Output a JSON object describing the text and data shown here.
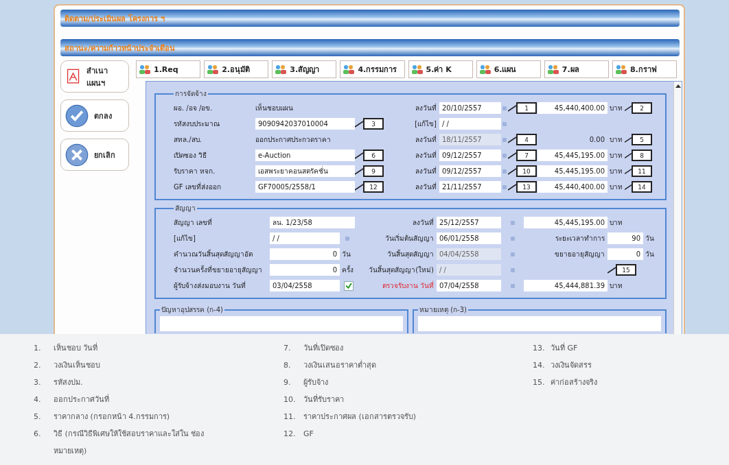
{
  "title_bars": [
    "ติดตาม/ประเมินผล โครงการ ฯ",
    "สถานะ/ความก้าวหน้าประจำเดือน"
  ],
  "side_buttons": [
    {
      "kind": "copy",
      "label": "สำเนา แผนฯ"
    },
    {
      "kind": "ok",
      "label": "ตกลง"
    },
    {
      "kind": "cancel",
      "label": "ยกเลิก"
    }
  ],
  "tabs": [
    {
      "label": "1.Req",
      "selected": false
    },
    {
      "label": "2.อนุมัติ",
      "selected": false
    },
    {
      "label": "3.สัญญา",
      "selected": false
    },
    {
      "label": "4.กรรมการ",
      "selected": false
    },
    {
      "label": "5.ค่า K",
      "selected": false
    },
    {
      "label": "6.แผน",
      "selected": false
    },
    {
      "label": "7.ผล",
      "selected": false
    },
    {
      "label": "8.กราฟ",
      "selected": false
    }
  ],
  "procurement": {
    "legend": "การจัดจ้าง",
    "rows": [
      {
        "label": "ผอ. /อจ /อข.",
        "value": {
          "kind": "text",
          "text": "เห็นชอบแผน"
        },
        "date_label": "ลงวันที่",
        "date": "20/10/2557",
        "date_disabled": false,
        "date_callout": "1",
        "amount": {
          "kind": "field",
          "text": "45,440,400.00"
        },
        "unit": "บาท",
        "amount_callout": "2"
      },
      {
        "label": "รหัสงบประมาณ",
        "value": {
          "kind": "field",
          "text": "9090942037010004"
        },
        "value_callout": "3",
        "date_label": "[แก้ไข]",
        "date": "/ /",
        "date_disabled": false
      },
      {
        "label": "สทล./สบ.",
        "value": {
          "kind": "text",
          "text": "ออกประกาศประกวดราคา"
        },
        "date_label": "ลงวันที่",
        "date": "18/11/2557",
        "date_disabled": true,
        "date_callout": "4",
        "amount": {
          "kind": "text",
          "text": "0.00"
        },
        "unit": "บาท",
        "amount_callout": "5"
      },
      {
        "label": "เปิดซอง วิธี",
        "value": {
          "kind": "field",
          "text": "e-Auction"
        },
        "value_callout": "6",
        "date_label": "ลงวันที่",
        "date": "09/12/2557",
        "date_disabled": false,
        "date_callout": "7",
        "amount": {
          "kind": "field",
          "text": "45,445,195.00"
        },
        "unit": "บาท",
        "amount_callout": "8"
      },
      {
        "label": "รับราคา หจก.",
        "value": {
          "kind": "field",
          "text": "เอสพระยาคอนสตรัคชั่น"
        },
        "value_callout": "9",
        "date_label": "ลงวันที่",
        "date": "09/12/2557",
        "date_disabled": false,
        "date_callout": "10",
        "amount": {
          "kind": "field",
          "text": "45,445,195.00"
        },
        "unit": "บาท",
        "amount_callout": "11"
      },
      {
        "label": "GF เลขที่ส่งออก",
        "value": {
          "kind": "field",
          "text": "GF70005/2558/1"
        },
        "value_callout": "12",
        "date_label": "ลงวันที่",
        "date": "21/11/2557",
        "date_disabled": false,
        "date_callout": "13",
        "amount": {
          "kind": "field",
          "text": "45,440,400.00"
        },
        "unit": "บาท",
        "amount_callout": "14"
      }
    ]
  },
  "contract": {
    "legend": "สัญญา",
    "rows": [
      {
        "kind": "wide",
        "a_label": "สัญญา เลขที่",
        "a_value": "ลน. 1/23/58",
        "b_label": "ลงวันที่",
        "b_value": "25/12/2557",
        "b_disabled": false,
        "c_value": "45,445,195.00",
        "c_unit": "บาท"
      },
      {
        "kind": "date",
        "a_label": "[แก้ไข]",
        "a_value": "/ /",
        "b_label": "วันเริ่มต้นสัญญา",
        "b_value": "06/01/2558",
        "b_disabled": false,
        "c_label": "ระยะเวลาทำการ",
        "c_value": "90",
        "c_unit": "วัน"
      },
      {
        "kind": "count",
        "a_label": "คำนวณวันสิ้นสุดสัญญาอัต",
        "a_value": "0",
        "a_unit": "วัน",
        "b_label": "วันสิ้นสุดสัญญา",
        "b_value": "04/04/2558",
        "b_disabled": true,
        "c_label": "ขยายอายุสัญญา",
        "c_value": "0",
        "c_unit": "วัน"
      },
      {
        "kind": "count",
        "a_label": "จำนวนครั้งที่ขยายอายุสัญญา",
        "a_value": "0",
        "a_unit": "ครั้ง",
        "b_label": "วันสิ้นสุดสัญญา(ใหม่)",
        "b_value": "/ /",
        "b_disabled": true,
        "callout": "15"
      },
      {
        "kind": "check",
        "a_label": "ผู้รับจ้างส่งมอบงาน วันที่",
        "a_value": "03/04/2558",
        "checked": true,
        "b_label": "ตรวจรับงาน วันที่",
        "b_value": "07/04/2558",
        "b_disabled": false,
        "c_value": "45,444,881.39",
        "c_unit": "บาท"
      }
    ]
  },
  "notes": [
    {
      "legend": "ปัญหาอุปสรรค (ก-4)"
    },
    {
      "legend": "หมายเหตุ (ก-3)"
    }
  ],
  "legend_columns": [
    [
      {
        "number": "1.",
        "text": "เห็นชอบ วันที่"
      },
      {
        "number": "2.",
        "text": "วงเงินเห็นชอบ"
      },
      {
        "number": "3.",
        "text": "รหัสงปม."
      },
      {
        "number": "4.",
        "text": "ออกประกาศวันที่"
      },
      {
        "number": "5.",
        "text": "ราคากลาง (กรอกหน้า 4.กรรมการ)"
      },
      {
        "number": "6.",
        "text": "วิธี (กรณีวิธีพิเศษให้ใช้สอบราคาและใส่ใน ช่องหมายเหตุ)"
      }
    ],
    [
      {
        "number": "7.",
        "text": "วันที่เปิดซอง"
      },
      {
        "number": "8.",
        "text": "วงเงินเสนอราคาต่ำสุด"
      },
      {
        "number": "9.",
        "text": "ผู้รับจ้าง"
      },
      {
        "number": "10.",
        "text": "วันที่รับราคา"
      },
      {
        "number": "11.",
        "text": "ราคาประกาศผล (เอกสารตรวจรับ)"
      },
      {
        "number": "12.",
        "text": "GF"
      }
    ],
    [
      {
        "number": "13.",
        "text": "วันที่ GF"
      },
      {
        "number": "14.",
        "text": "วงเงินจัดสรร"
      },
      {
        "number": "15.",
        "text": "ค่าก่อสร้างจริง"
      }
    ]
  ]
}
